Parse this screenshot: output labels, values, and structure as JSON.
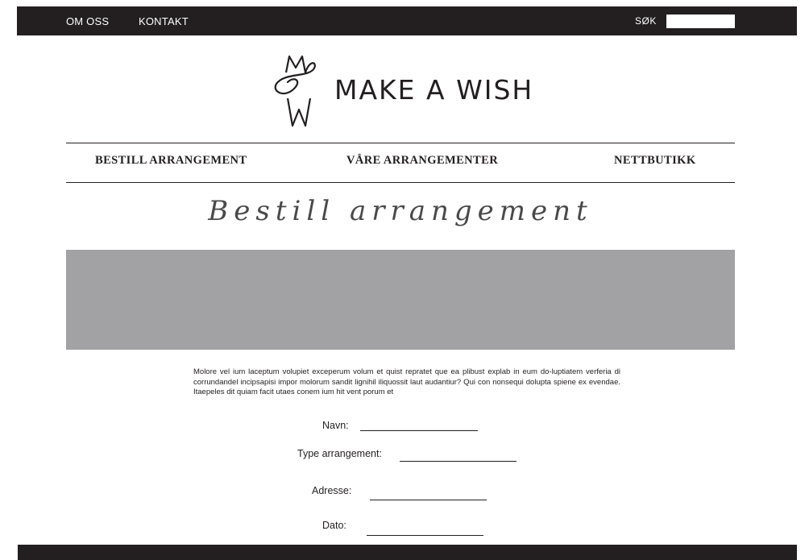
{
  "topbar": {
    "links": [
      "OM OSS",
      "KONTAKT"
    ],
    "search_label": "SØK",
    "search_value": ""
  },
  "logo": {
    "text": "MAKE A WISH",
    "monogram": "MW"
  },
  "nav": {
    "items": [
      "BESTILL ARRANGEMENT",
      "VÅRE ARRANGEMENTER",
      "NETTBUTIKK"
    ]
  },
  "page": {
    "title": "Bestill arrangement",
    "intro": "Molore vel ium laceptum volupiet exceperum volum et quist repratet que ea plibust explab in eum do-luptiatem verferia di corrundandel incipsapisi impor molorum sandit lignihil iliquossit laut audantiur? Qui con nonsequi dolupta spiene ex evendae. Itaepeles dit quiam facit utaes conem ium hit vent porum et"
  },
  "form": {
    "fields": [
      {
        "label": "Navn:",
        "value": ""
      },
      {
        "label": "Type arrangement:",
        "value": ""
      },
      {
        "label": "Adresse:",
        "value": ""
      },
      {
        "label": "Dato:",
        "value": ""
      }
    ]
  },
  "colors": {
    "dark": "#231f20",
    "hero_gray": "#a2a2a5",
    "background": "#ffffff"
  },
  "icons": {
    "logo_mark": "mw-monogram-icon"
  }
}
